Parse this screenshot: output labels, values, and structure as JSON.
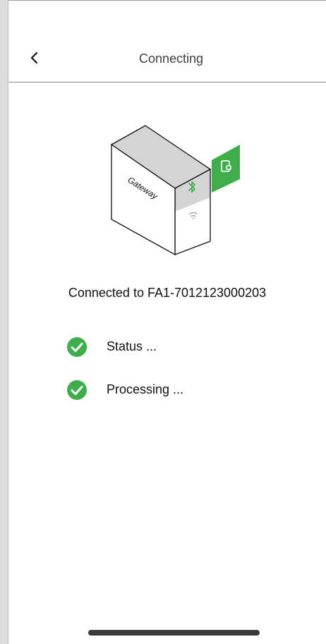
{
  "header": {
    "title": "Connecting",
    "back_icon": "chevron-left-icon"
  },
  "illustration": {
    "device_label": "Gateway",
    "bluetooth_icon": "bluetooth-icon",
    "wifi_icon": "wifi-icon",
    "phone_icon": "phone-icon",
    "accent_color": "#3dae49"
  },
  "connection": {
    "message": "Connected to FA1-7012123000203"
  },
  "steps": [
    {
      "label": "Status ...",
      "icon": "check-circle-icon",
      "state": "done"
    },
    {
      "label": "Processing ...",
      "icon": "check-circle-icon",
      "state": "done"
    }
  ],
  "colors": {
    "success": "#3dae49",
    "text": "#111111",
    "header_text": "#404040"
  }
}
